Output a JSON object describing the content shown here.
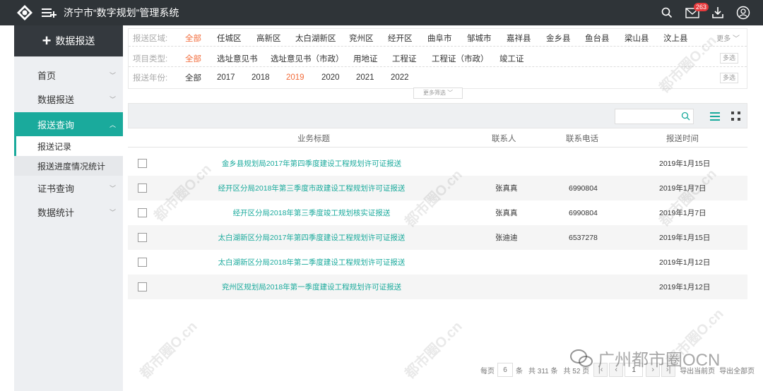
{
  "app": {
    "title": "济宁市“数字规划”管理系统",
    "message_count": "263"
  },
  "sidebar": {
    "report_button": "数据报送",
    "items": [
      {
        "label": "首页"
      },
      {
        "label": "数据报送"
      },
      {
        "label": "报送查询"
      },
      {
        "label": "证书查询"
      },
      {
        "label": "数据统计"
      }
    ],
    "sub_items": [
      {
        "label": "报送记录"
      },
      {
        "label": "报送进度情况统计"
      }
    ]
  },
  "filters": {
    "region": {
      "label": "报送区域:",
      "options": [
        "全部",
        "任城区",
        "高新区",
        "太白湖新区",
        "兖州区",
        "经开区",
        "曲阜市",
        "邹城市",
        "嘉祥县",
        "金乡县",
        "鱼台县",
        "梁山县",
        "汶上县"
      ],
      "selected": "全部",
      "more_label": "更多"
    },
    "project_type": {
      "label": "项目类型:",
      "options": [
        "全部",
        "选址意见书",
        "选址意见书（市政）",
        "用地证",
        "工程证",
        "工程证（市政）",
        "竣工证"
      ],
      "selected": "全部",
      "multi_label": "多选"
    },
    "year": {
      "label": "报送年份:",
      "options": [
        "全部",
        "2017",
        "2018",
        "2019",
        "2020",
        "2021",
        "2022"
      ],
      "selected": "2019",
      "multi_label": "多选"
    },
    "more_filter_label": "更多筛选"
  },
  "table": {
    "columns": [
      "业务标题",
      "联系人",
      "联系电话",
      "报送时间"
    ],
    "rows": [
      {
        "title": "金乡县规划局2017年第四季度建设工程规划许可证报送",
        "contact": "",
        "phone": "",
        "date": "2019年1月15日"
      },
      {
        "title": "经开区分局2018年第三季度市政建设工程规划许可证报送",
        "contact": "张真真",
        "phone": "6990804",
        "date": "2019年1月7日"
      },
      {
        "title": "经开区分局2018年第三季度竣工规划核实证报送",
        "contact": "张真真",
        "phone": "6990804",
        "date": "2019年1月7日"
      },
      {
        "title": "太白湖新区分局2017年第四季度建设工程规划许可证报送",
        "contact": "张迪迪",
        "phone": "6537278",
        "date": "2019年1月15日"
      },
      {
        "title": "太白湖新区分局2018年第二季度建设工程规划许可证报送",
        "contact": "",
        "phone": "",
        "date": "2019年1月12日"
      },
      {
        "title": "兖州区规划局2018年第一季度建设工程规划许可证报送",
        "contact": "",
        "phone": "",
        "date": "2019年1月12日"
      }
    ]
  },
  "pagination": {
    "per_page_label": "每页",
    "per_page": "6",
    "unit": "条",
    "total_label": "共 311 条",
    "pages_label": "共 52 页",
    "current_page": "1",
    "export_current": "导出当前页",
    "export_all": "导出全部页"
  },
  "watermark": {
    "text": "都市圈O.cn",
    "brand": "广州都市圈OCN"
  },
  "colors": {
    "accent": "#1aaa9c",
    "selected": "#f26b3a",
    "topbar": "#2f3438"
  }
}
